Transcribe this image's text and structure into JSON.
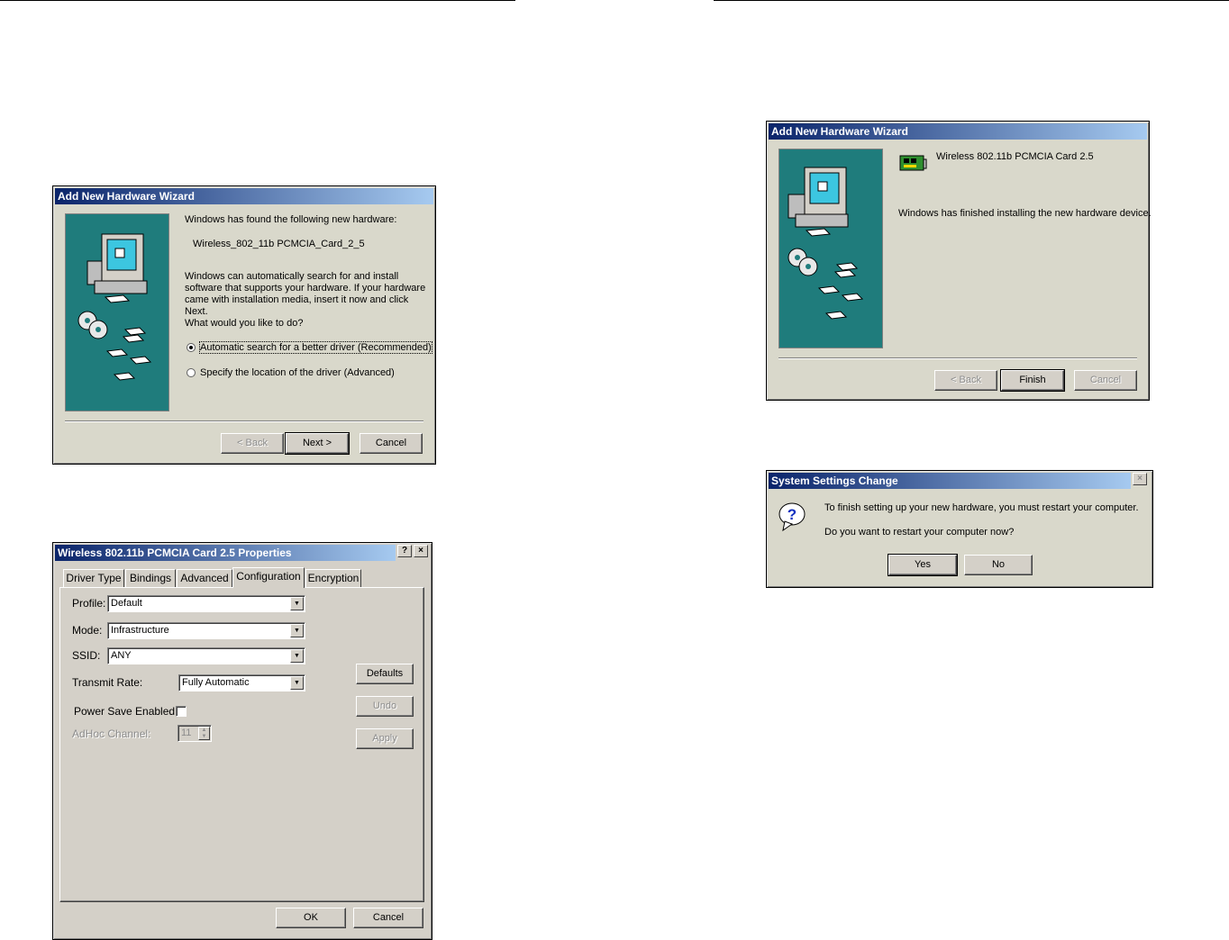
{
  "wizard1": {
    "title": "Add New Hardware Wizard",
    "found_text": "Windows has found the following new hardware:",
    "device_name": "Wireless_802_11b PCMCIA_Card_2_5",
    "description": "Windows can automatically search for and install software that supports your hardware. If your hardware came with installation media, insert it now and click Next.",
    "question": "What would you like to do?",
    "options": [
      {
        "label": "Automatic search for a better driver (Recommended)",
        "selected": true
      },
      {
        "label": "Specify the location of the driver (Advanced)",
        "selected": false
      }
    ],
    "buttons": {
      "back": "< Back",
      "next": "Next >",
      "cancel": "Cancel"
    }
  },
  "properties": {
    "title": "Wireless 802.11b PCMCIA Card 2.5 Properties",
    "title_buttons": {
      "help": "?",
      "close": "×"
    },
    "tabs": [
      "Driver Type",
      "Bindings",
      "Advanced",
      "Configuration",
      "Encryption"
    ],
    "active_tab": "Configuration",
    "fields": {
      "profile": {
        "label": "Profile:",
        "value": "Default"
      },
      "mode": {
        "label": "Mode:",
        "value": "Infrastructure"
      },
      "ssid": {
        "label": "SSID:",
        "value": "ANY"
      },
      "transmit_rate": {
        "label": "Transmit Rate:",
        "value": "Fully Automatic"
      },
      "power_save": {
        "label": "Power Save Enabled",
        "checked": false
      },
      "adhoc_channel": {
        "label": "AdHoc Channel:",
        "value": "11"
      }
    },
    "side_buttons": {
      "defaults": "Defaults",
      "undo": "Undo",
      "apply": "Apply"
    },
    "buttons": {
      "ok": "OK",
      "cancel": "Cancel"
    }
  },
  "wizard2": {
    "title": "Add New Hardware Wizard",
    "device_name": "Wireless 802.11b PCMCIA Card 2.5",
    "message": "Windows has finished installing the new hardware device.",
    "buttons": {
      "back": "< Back",
      "finish": "Finish",
      "cancel": "Cancel"
    }
  },
  "restart_dialog": {
    "title": "System Settings Change",
    "close": "×",
    "message": "To finish setting up your new hardware, you must restart your computer.",
    "question": "Do you want to restart your computer now?",
    "buttons": {
      "yes": "Yes",
      "no": "No"
    }
  }
}
